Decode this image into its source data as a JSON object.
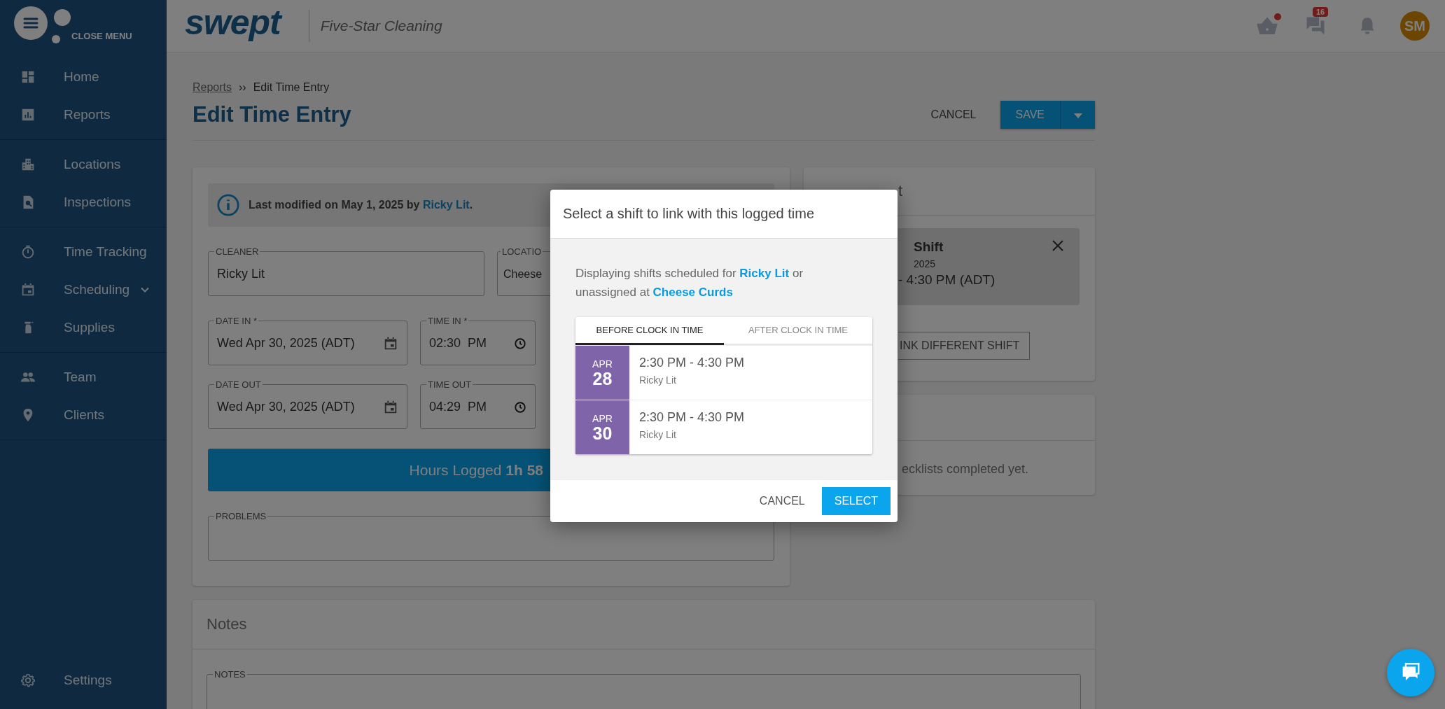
{
  "sidebar": {
    "close_label": "CLOSE MENU",
    "groups": [
      [
        {
          "label": "Home",
          "has_submenu": false
        },
        {
          "label": "Reports",
          "has_submenu": false
        }
      ],
      [
        {
          "label": "Locations",
          "has_submenu": false
        },
        {
          "label": "Inspections",
          "has_submenu": false
        }
      ],
      [
        {
          "label": "Time Tracking",
          "has_submenu": false
        },
        {
          "label": "Scheduling",
          "has_submenu": true
        },
        {
          "label": "Supplies",
          "has_submenu": false
        }
      ],
      [
        {
          "label": "Team",
          "has_submenu": false
        },
        {
          "label": "Clients",
          "has_submenu": false
        }
      ]
    ],
    "footer_item": {
      "label": "Settings"
    }
  },
  "header": {
    "logo": "swept",
    "company": "Five-Star Cleaning",
    "basket_alert": true,
    "messages_badge": "16",
    "avatar": {
      "initials": "SM"
    }
  },
  "breadcrumb": [
    {
      "label": "Reports",
      "link": true
    },
    {
      "label": "Edit Time Entry",
      "link": false
    }
  ],
  "breadcrumb_separator": "››",
  "page_title": "Edit Time Entry",
  "actions": {
    "cancel": "CANCEL",
    "save": "SAVE"
  },
  "info": {
    "text": "Last modified on May 1, 2025 by",
    "link": "Ricky Lit",
    "suffix": "."
  },
  "cleaner": {
    "label": "CLEANER",
    "value": "Ricky Lit"
  },
  "location": {
    "label": "LOCATIO",
    "value": "Cheese"
  },
  "date_time_rows": [
    {
      "date": {
        "label": "DATE IN *",
        "value": "Wed Apr 30, 2025 (ADT)"
      },
      "time": {
        "label": "TIME IN *",
        "value": "02:30  PM"
      }
    },
    {
      "date": {
        "label": "DATE OUT",
        "value": "Wed Apr 30, 2025 (ADT)"
      },
      "time": {
        "label": "TIME OUT",
        "value": "04:29  PM"
      }
    }
  ],
  "hours": {
    "label": "Hours Logged",
    "value": "1h 58"
  },
  "problems": {
    "label": "PROBLEMS"
  },
  "linked_shift": {
    "title": "t",
    "name": "Shift",
    "date": "2025",
    "time": "- 4:30 PM (ADT)",
    "link_button": "INK DIFFERENT SHIFT"
  },
  "checklists": {
    "empty": "ecklists completed yet."
  },
  "notes": {
    "title": "Notes",
    "label": "NOTES"
  },
  "modal": {
    "title": "Select a shift to link with this logged time",
    "intro": {
      "before": "Displaying shifts scheduled for",
      "cleaner": "Ricky Lit",
      "middle": "or unassigned at",
      "location": "Cheese Curds"
    },
    "tabs": [
      {
        "label": "BEFORE CLOCK IN TIME",
        "selected": true
      },
      {
        "label": "AFTER CLOCK IN TIME",
        "selected": false
      }
    ],
    "shifts": [
      {
        "month": "APR",
        "day": "28",
        "time": "2:30 PM - 4:30 PM",
        "cleaner": "Ricky Lit"
      },
      {
        "month": "APR",
        "day": "30",
        "time": "2:30 PM - 4:30 PM",
        "cleaner": "Ricky Lit"
      }
    ],
    "buttons": {
      "cancel": "CANCEL",
      "select": "SELECT"
    }
  }
}
